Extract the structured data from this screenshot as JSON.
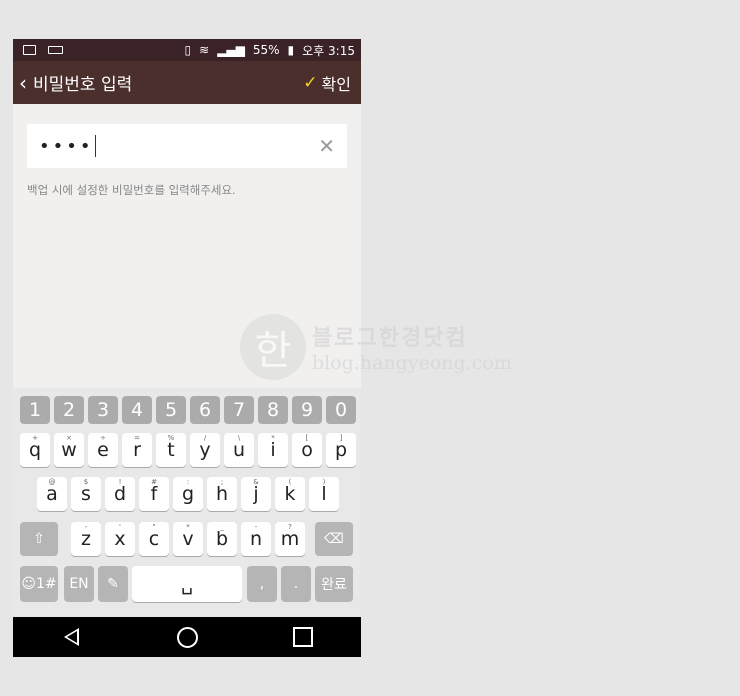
{
  "status_bar": {
    "battery": "55%",
    "time": "오후 3:15"
  },
  "app_bar": {
    "title": "비밀번호 입력",
    "confirm_label": "확인"
  },
  "password_field": {
    "value": "••••"
  },
  "hint": "백업 시에 설정한 비밀번호를 입력해주세요.",
  "keyboard": {
    "numbers": [
      "1",
      "2",
      "3",
      "4",
      "5",
      "6",
      "7",
      "8",
      "9",
      "0"
    ],
    "row1": [
      {
        "k": "q",
        "s": "+"
      },
      {
        "k": "w",
        "s": "×"
      },
      {
        "k": "e",
        "s": "÷"
      },
      {
        "k": "r",
        "s": "="
      },
      {
        "k": "t",
        "s": "%"
      },
      {
        "k": "y",
        "s": "/"
      },
      {
        "k": "u",
        "s": "\\"
      },
      {
        "k": "i",
        "s": "*"
      },
      {
        "k": "o",
        "s": "["
      },
      {
        "k": "p",
        "s": "]"
      }
    ],
    "row2": [
      {
        "k": "a",
        "s": "@"
      },
      {
        "k": "s",
        "s": "$"
      },
      {
        "k": "d",
        "s": "!"
      },
      {
        "k": "f",
        "s": "#"
      },
      {
        "k": "g",
        "s": ":"
      },
      {
        "k": "h",
        "s": ";"
      },
      {
        "k": "j",
        "s": "&"
      },
      {
        "k": "k",
        "s": "("
      },
      {
        "k": "l",
        "s": ")"
      }
    ],
    "row3": [
      {
        "k": "z",
        "s": "-"
      },
      {
        "k": "x",
        "s": "'"
      },
      {
        "k": "c",
        "s": "\""
      },
      {
        "k": "v",
        "s": "*"
      },
      {
        "k": "b",
        "s": "_"
      },
      {
        "k": "n",
        "s": "-"
      },
      {
        "k": "m",
        "s": "?"
      }
    ],
    "symbols_label": "☺1#",
    "lang_label": "EN",
    "comma": ",",
    "period": ".",
    "done_label": "완료"
  },
  "watermark": {
    "logo": "한",
    "text_ko": "블로그한경닷컴",
    "text_url": "blog.hangyeong.com"
  }
}
